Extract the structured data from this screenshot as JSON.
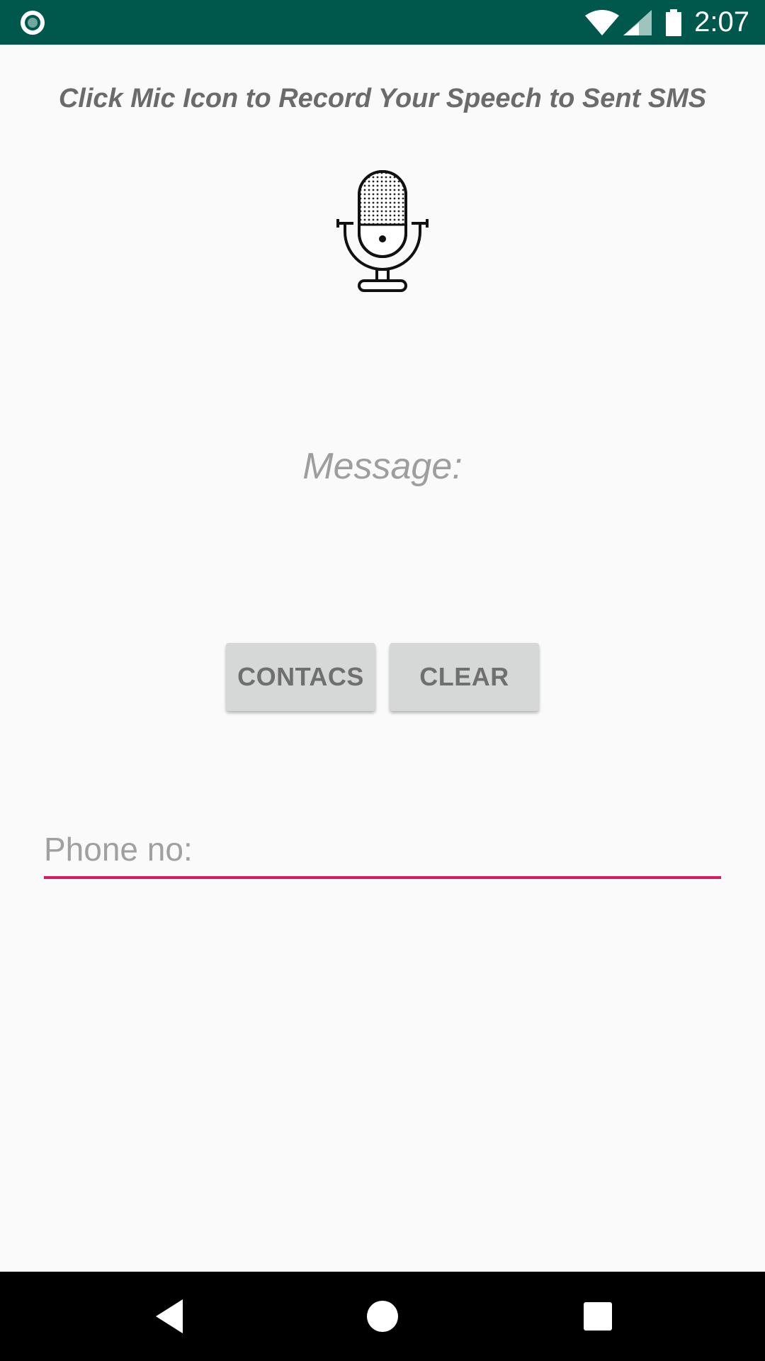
{
  "status_bar": {
    "time": "2:07",
    "background_color": "#00574b",
    "icons": [
      "notification-icon",
      "wifi-icon",
      "signal-icon",
      "battery-icon"
    ]
  },
  "main": {
    "instruction": "Click Mic Icon to Record Your Speech to Sent SMS",
    "mic_icon": "microphone-icon",
    "message_label": "Message:",
    "buttons": {
      "contacts": "CONTACS",
      "clear": "CLEAR"
    },
    "phone_field": {
      "placeholder": "Phone no:",
      "value": "",
      "accent_color": "#d81b60"
    }
  },
  "nav_bar": {
    "icons": [
      "back-icon",
      "home-icon",
      "recents-icon"
    ]
  }
}
